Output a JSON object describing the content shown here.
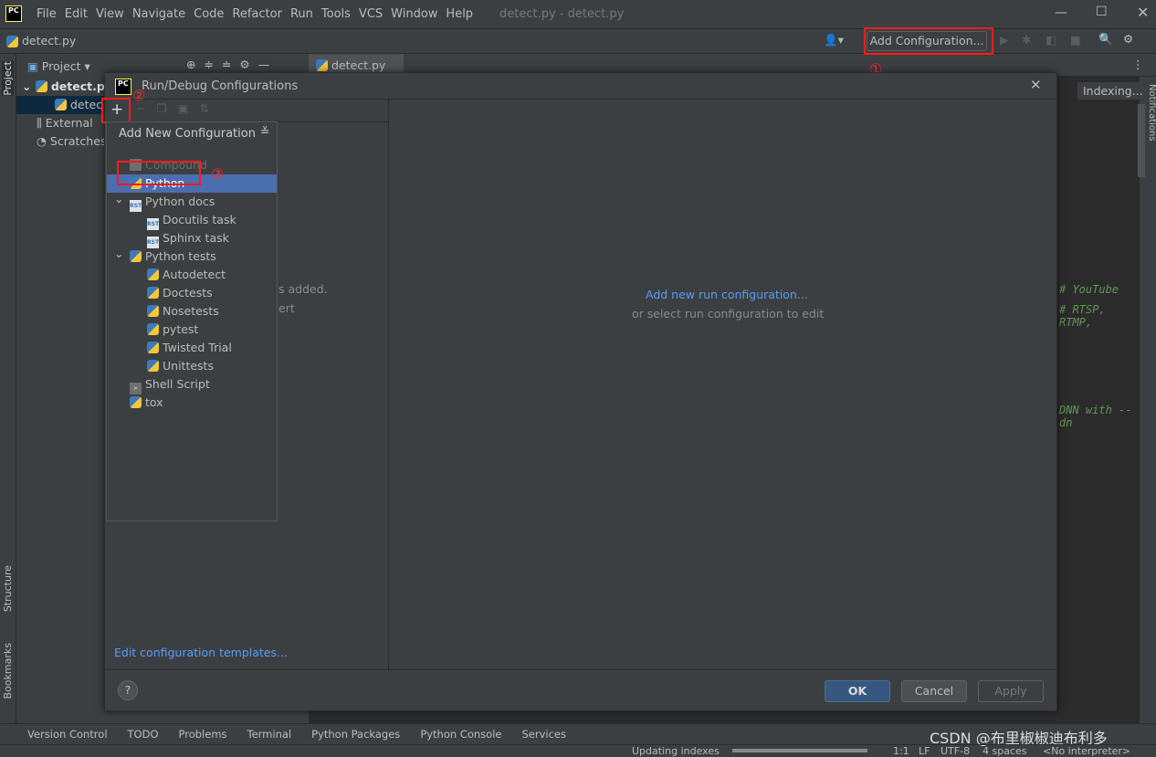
{
  "window": {
    "title": "detect.py - detect.py",
    "logo": "PC"
  },
  "menu": [
    "File",
    "Edit",
    "View",
    "Navigate",
    "Code",
    "Refactor",
    "Run",
    "Tools",
    "VCS",
    "Window",
    "Help"
  ],
  "navbar": {
    "file": "detect.py",
    "add_config": "Add Configuration..."
  },
  "project": {
    "header": "Project",
    "items": [
      "detect.py",
      "detec",
      "External",
      "Scratches"
    ]
  },
  "left_strip": {
    "project": "Project",
    "structure": "Structure",
    "bookmarks": "Bookmarks"
  },
  "right_strip": {
    "notifications": "Notifications"
  },
  "editor": {
    "tab": "detect.py",
    "indexing": "Indexing...",
    "code_lines": [
      "# YouTube",
      "# RTSP, RTMP,",
      "DNN with --dn"
    ]
  },
  "dialog": {
    "title": "Run/Debug Configurations",
    "empty_left": [
      "s added.",
      "ert"
    ],
    "add_new_link": "Add new run configuration...",
    "or_select": "or select run configuration to edit",
    "edit_templates": "Edit configuration templates...",
    "help": "?",
    "ok": "OK",
    "cancel": "Cancel",
    "apply": "Apply"
  },
  "popup": {
    "title": "Add New Configuration",
    "items": [
      {
        "label": "Compound",
        "icon": "folder-icon",
        "level": 0,
        "disabled": true
      },
      {
        "label": "Python",
        "icon": "python-icon",
        "level": 0,
        "selected": true
      },
      {
        "label": "Python docs",
        "icon": "rst-icon",
        "level": 0,
        "expanded": true
      },
      {
        "label": "Docutils task",
        "icon": "rst-icon",
        "level": 1
      },
      {
        "label": "Sphinx task",
        "icon": "rst-icon",
        "level": 1
      },
      {
        "label": "Python tests",
        "icon": "python-test-icon",
        "level": 0,
        "expanded": true
      },
      {
        "label": "Autodetect",
        "icon": "python-test-icon",
        "level": 1
      },
      {
        "label": "Doctests",
        "icon": "python-test-icon",
        "level": 1
      },
      {
        "label": "Nosetests",
        "icon": "python-test-icon",
        "level": 1
      },
      {
        "label": "pytest",
        "icon": "python-test-icon",
        "level": 1
      },
      {
        "label": "Twisted Trial",
        "icon": "python-test-icon",
        "level": 1
      },
      {
        "label": "Unittests",
        "icon": "python-test-icon",
        "level": 1
      },
      {
        "label": "Shell Script",
        "icon": "shell-icon",
        "level": 0
      },
      {
        "label": "tox",
        "icon": "python-test-icon",
        "level": 0
      }
    ]
  },
  "annotations": {
    "a1": "①",
    "a2": "②",
    "a3": "③"
  },
  "bottom_tools": [
    "Version Control",
    "TODO",
    "Problems",
    "Terminal",
    "Python Packages",
    "Python Console",
    "Services"
  ],
  "status": {
    "updating": "Updating indexes",
    "pos": "1:1",
    "le": "LF",
    "enc": "UTF-8",
    "indent": "4 spaces",
    "interp": "<No interpreter>"
  },
  "watermark": "CSDN @布里椒椒迪布利多",
  "colors": {
    "accent": "#4b6eaf",
    "link": "#589df6",
    "annotation": "#ff1a1a",
    "ok": "#365880"
  }
}
